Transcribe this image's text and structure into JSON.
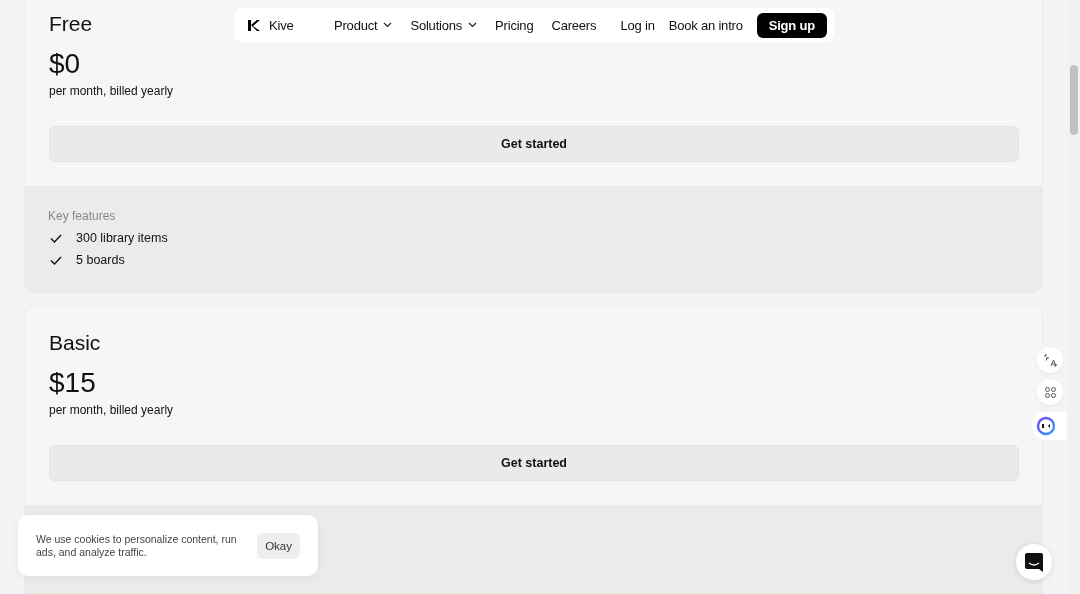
{
  "nav": {
    "brand": "Kive",
    "links": [
      {
        "label": "Product",
        "dropdown": true
      },
      {
        "label": "Solutions",
        "dropdown": true
      },
      {
        "label": "Pricing",
        "dropdown": false
      },
      {
        "label": "Careers",
        "dropdown": false
      }
    ],
    "login": "Log in",
    "intro": "Book an intro",
    "signup": "Sign up"
  },
  "plans": [
    {
      "name": "Free",
      "price": "$0",
      "billing": "per month, billed yearly",
      "cta": "Get started",
      "features_heading": "Key features",
      "features": [
        "300 library items",
        "5 boards"
      ]
    },
    {
      "name": "Basic",
      "price": "$15",
      "billing": "per month, billed yearly",
      "cta": "Get started"
    }
  ],
  "cookie": {
    "text": "We use cookies to personalize content, run ads, and analyze traffic.",
    "button": "Okay"
  }
}
